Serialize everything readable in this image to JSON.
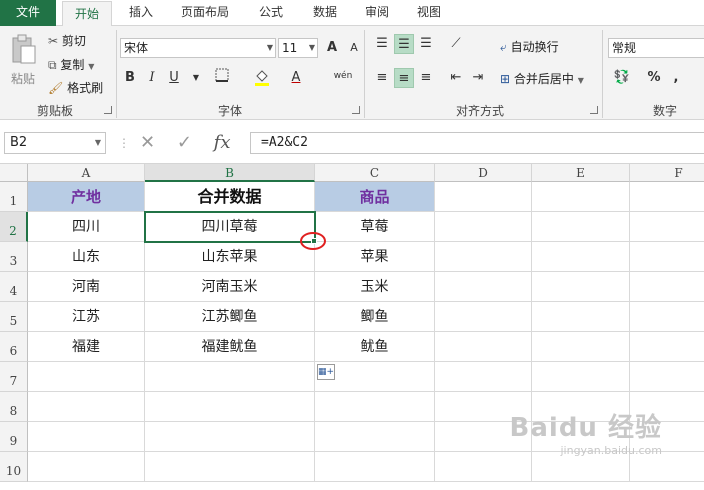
{
  "tabs": [
    {
      "label": "文件",
      "kind": "file"
    },
    {
      "label": "开始",
      "kind": "active"
    },
    {
      "label": "插入",
      "kind": ""
    },
    {
      "label": "页面布局",
      "kind": ""
    },
    {
      "label": "公式",
      "kind": ""
    },
    {
      "label": "数据",
      "kind": ""
    },
    {
      "label": "审阅",
      "kind": ""
    },
    {
      "label": "视图",
      "kind": ""
    }
  ],
  "ribbon": {
    "clipboard": {
      "paste": "粘贴",
      "cut": "剪切",
      "copy": "复制",
      "format_painter": "格式刷",
      "group": "剪贴板"
    },
    "font": {
      "name": "宋体",
      "size": "11",
      "bold": "B",
      "italic": "I",
      "underline": "U",
      "font_color": "A",
      "phonetic": "wén",
      "grow": "A",
      "shrink": "A",
      "group": "字体"
    },
    "alignment": {
      "wrap": "自动换行",
      "merge": "合并后居中",
      "group": "对齐方式"
    },
    "number": {
      "format": "常规",
      "percent": "%",
      "comma": ",",
      "group": "数字"
    }
  },
  "formula_bar": {
    "name_box": "B2",
    "cancel": "✕",
    "enter": "✓",
    "fx": "fx",
    "formula": "=A2&C2"
  },
  "columns": [
    "A",
    "B",
    "C",
    "D",
    "E",
    "F"
  ],
  "rows": [
    "1",
    "2",
    "3",
    "4",
    "5",
    "6",
    "7",
    "8",
    "9",
    "10"
  ],
  "cells": {
    "headers": [
      "产地",
      "合并数据",
      "商品"
    ],
    "data": [
      [
        "四川",
        "四川草莓",
        "草莓"
      ],
      [
        "山东",
        "山东苹果",
        "苹果"
      ],
      [
        "河南",
        "河南玉米",
        "玉米"
      ],
      [
        "江苏",
        "江苏鲫鱼",
        "鲫鱼"
      ],
      [
        "福建",
        "福建鱿鱼",
        "鱿鱼"
      ]
    ]
  },
  "colors": {
    "excel_green": "#217346",
    "header_fill": "#b8cce4",
    "header_text": "#7030a0",
    "highlight": "#e02020"
  },
  "watermark": {
    "line1": "Baidu 经验",
    "line2": "jingyan.baidu.com"
  }
}
